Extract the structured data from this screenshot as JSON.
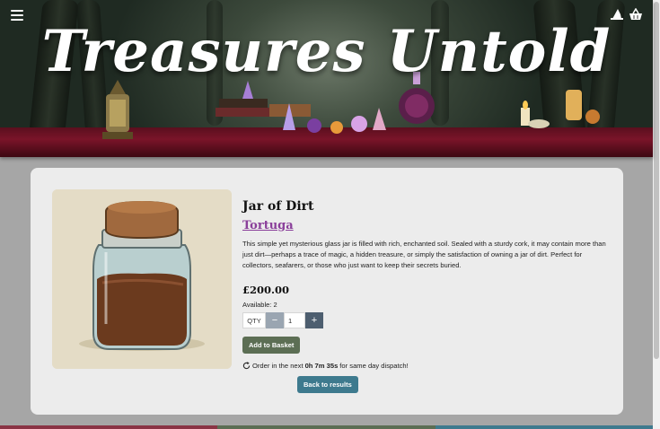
{
  "header": {
    "title": "Treasures Untold",
    "menu_icon": "hamburger-menu-icon",
    "account_icon": "wizard-hat-icon",
    "basket_icon": "basket-icon"
  },
  "product": {
    "title": "Jar of Dirt",
    "seller": "Tortuga",
    "description": "This simple yet mysterious glass jar is filled with rich, enchanted soil. Sealed with a sturdy cork, it may contain more than just dirt—perhaps a trace of magic, a hidden treasure, or simply the satisfaction of owning a jar of dirt. Perfect for collectors, seafarers, or those who just want to keep their secrets buried.",
    "price": "£200.00",
    "available": "Available: 2",
    "qty_label": "QTY",
    "qty_value": "1",
    "minus": "−",
    "plus": "+",
    "add_to_basket": "Add to Basket",
    "dispatch_prefix": "Order in the next",
    "dispatch_time": "0h 7m 35s",
    "dispatch_suffix": "for same day dispatch!",
    "back": "Back to results"
  },
  "colors": {
    "seller_link": "#8a3f9a",
    "add_button": "#5c6e54",
    "back_button": "#3e7a8e",
    "qty_plus": "#4d5e6f",
    "qty_minus": "#9aa5b1",
    "footer_bars": [
      "#8a3445",
      "#5c6e54",
      "#3e7a8e"
    ]
  }
}
